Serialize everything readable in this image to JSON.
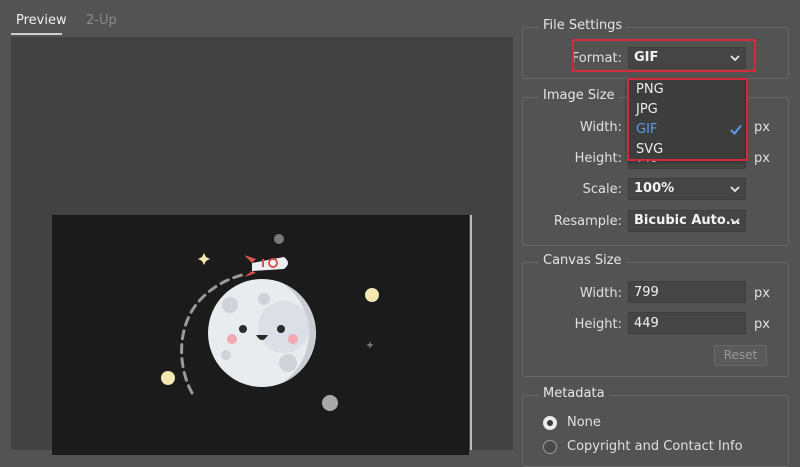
{
  "tabs": [
    {
      "label": "Preview",
      "active": true
    },
    {
      "label": "2-Up",
      "active": false
    }
  ],
  "file_settings": {
    "legend": "File Settings",
    "format_label": "Format:",
    "format_value": "GIF",
    "options": [
      {
        "label": "PNG",
        "selected": false
      },
      {
        "label": "JPG",
        "selected": false
      },
      {
        "label": "GIF",
        "selected": true
      },
      {
        "label": "SVG",
        "selected": false
      }
    ]
  },
  "image_size": {
    "legend": "Image Size",
    "width_label": "Width:",
    "height_label": "Height:",
    "height_value": "449",
    "unit": "px",
    "scale_label": "Scale:",
    "scale_value": "100%",
    "resample_label": "Resample:",
    "resample_value": "Bicubic Auto..."
  },
  "canvas_size": {
    "legend": "Canvas Size",
    "width_label": "Width:",
    "width_value": "799",
    "height_label": "Height:",
    "height_value": "449",
    "unit": "px",
    "reset_label": "Reset"
  },
  "metadata": {
    "legend": "Metadata",
    "options": [
      {
        "label": "None",
        "selected": true
      },
      {
        "label": "Copyright and Contact Info",
        "selected": false
      }
    ]
  },
  "colors": {
    "highlight_red": "#d22b3b",
    "selected_blue": "#5c9be6"
  }
}
